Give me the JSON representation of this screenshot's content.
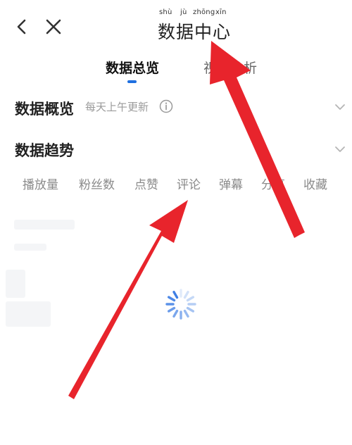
{
  "nav": {
    "back_icon": "chevron-left-icon",
    "close_icon": "close-icon"
  },
  "title": {
    "chars": [
      "数",
      "据",
      "中",
      "心"
    ],
    "pinyin": [
      "shù",
      "jù",
      "zhōng",
      "xīn"
    ]
  },
  "tabs": [
    {
      "label": "数据总览"
    },
    {
      "label": "视频分析"
    }
  ],
  "overview": {
    "title": "数据概览",
    "subtitle": "每天上午更新",
    "info_icon": "info-icon",
    "expand_icon": "chevron-down-icon"
  },
  "trend": {
    "title": "数据趋势",
    "expand_icon": "chevron-down-icon",
    "metrics": [
      "播放量",
      "粉丝数",
      "点赞",
      "评论",
      "弹幕",
      "分享",
      "收藏"
    ]
  },
  "colors": {
    "accent": "#1f6fe0",
    "arrow": "#e8242c",
    "spinner": "#3f7fe4"
  }
}
